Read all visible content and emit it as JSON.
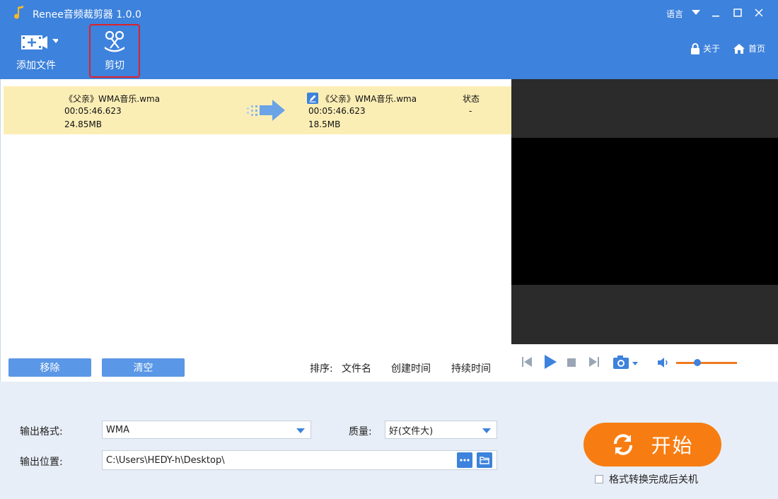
{
  "window": {
    "title": "Renee音频裁剪器 1.0.0",
    "language_label": "语言"
  },
  "toolbar": {
    "add_file_label": "添加文件",
    "cut_label": "剪切",
    "about_label": "关于",
    "home_label": "首页"
  },
  "file_list": {
    "items": [
      {
        "source_name": "《父亲》WMA音乐.wma",
        "source_duration": "00:05:46.623",
        "source_size": "24.85MB",
        "output_name": "《父亲》WMA音乐.wma",
        "output_duration": "00:05:46.623",
        "output_size": "18.5MB",
        "status_header": "状态",
        "status": "-"
      }
    ],
    "remove_label": "移除",
    "clear_label": "清空",
    "sort_label": "排序:",
    "sort_by_name": "文件名",
    "sort_by_created": "创建时间",
    "sort_by_duration": "持续时间"
  },
  "player": {
    "volume_level": 0.35
  },
  "settings": {
    "format_label": "输出格式:",
    "format_value": "WMA",
    "quality_label": "质量:",
    "quality_value": "好(文件大)",
    "location_label": "输出位置:",
    "location_value": "C:\\Users\\HEDY-h\\Desktop\\",
    "start_label": "开始",
    "shutdown_label": "格式转换完成后关机"
  },
  "colors": {
    "header_blue": "#3d82dc",
    "row_highlight": "#fbeeb5",
    "start_orange": "#f77d12",
    "highlight_frame": "#e0202a"
  }
}
